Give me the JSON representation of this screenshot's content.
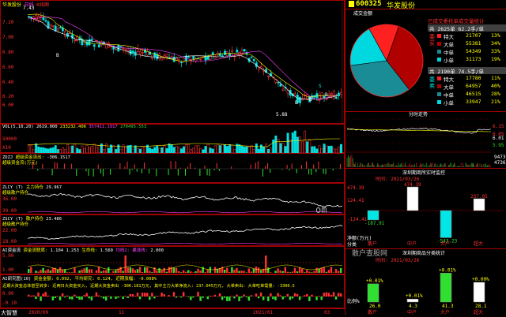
{
  "stock": {
    "code": "600325",
    "name": "华发股份"
  },
  "main_chart": {
    "title_left": "华发股份",
    "title_tags": [
      "日线",
      "K线图"
    ],
    "y_ticks": [
      "7.20",
      "7.00",
      "6.80",
      "6.60",
      "6.40",
      "6.20",
      "6.00"
    ],
    "high_label": "7.43",
    "low_label": "5.88",
    "marks": [
      "B",
      "S",
      "B",
      "B",
      "S",
      "B"
    ]
  },
  "vol_panel": {
    "title": "VOL(5,10,20)",
    "values": [
      "2619.000",
      "233232.406",
      "357411.1917",
      "270495.553"
    ],
    "y_ticks": [
      "50000",
      "X10"
    ]
  },
  "zdzj_panel": {
    "title": "ZDZJ",
    "subtitle": "超级资金流出:",
    "value": "-306.1517",
    "label2": "超级资金流(万元)"
  },
  "zlcy_panel": {
    "title": "ZLCY (T)",
    "subtitle": "主力持仓",
    "value": "29.967",
    "label2": "超级散户持仓",
    "y_ticks": [
      "36.00",
      "30.00"
    ]
  },
  "shcy_panel": {
    "title": "ZSCY (T)",
    "subtitle": "散户持仓",
    "value": "23.486",
    "label2": "超级散户持仓",
    "y_ticks": [
      "22.00",
      "18.00"
    ]
  },
  "kdj_panel": {
    "title": "AI资金流",
    "subtitle": "资金流联席:",
    "values": [
      "1.104",
      "1.253",
      "1.560",
      "2.000"
    ],
    "labels": [
      "生命线:",
      "均线2:",
      "暴涨线:"
    ],
    "y_ticks": [
      "5.00",
      "1.00"
    ]
  },
  "ai_panel": {
    "title": "AI研究图(10)",
    "text1": "资金金额: 0.092, 平均研究: 0.124, 近期涨幅: -0.008%",
    "text2": "近期大资金总体甚至转多: 近两日大资金买入, 近期大资金卖出 -306.181万元, 其中主力大单净流入: 237.045万元, 大单卖出: 大单吃单需量: -3300.5",
    "y_ticks": [
      "0.00",
      "-0.10"
    ]
  },
  "bottom_axis": {
    "labels": [
      "大智慧",
      "2020/09",
      "11",
      "2021/01",
      "03"
    ]
  },
  "pie_panel": {
    "title": "成交金额",
    "header": "已成交委托单成交量统计",
    "slices": [
      {
        "name": "特大",
        "value": 21707,
        "pct": 13,
        "color": "#ff2020"
      },
      {
        "name": "大单",
        "value": 55381,
        "pct": 34,
        "color": "#b00000"
      },
      {
        "name": "中单",
        "value": 54349,
        "pct": 33,
        "color": "#1a8c96"
      },
      {
        "name": "小单",
        "value": 31173,
        "pct": 19,
        "color": "#00d8e0"
      }
    ],
    "buy_title": "共 2625单 62.2手/单",
    "buy_side": "委买",
    "buy_rows": [
      {
        "name": "特大",
        "value": "21707",
        "pct": "13%"
      },
      {
        "name": "大单",
        "value": "55381",
        "pct": "34%"
      },
      {
        "name": "中单",
        "value": "54349",
        "pct": "33%"
      },
      {
        "name": "小单",
        "value": "31173",
        "pct": "19%"
      }
    ],
    "sell_title": "共 2190单 74.5手/单",
    "sell_side": "委卖",
    "sell_rows": [
      {
        "name": "特大",
        "value": "17780",
        "pct": "11%"
      },
      {
        "name": "大单",
        "value": "64957",
        "pct": "40%"
      },
      {
        "name": "中单",
        "value": "46515",
        "pct": "28%"
      },
      {
        "name": "小单",
        "value": "33947",
        "pct": "21%"
      }
    ]
  },
  "intraday": {
    "title": "分时走势",
    "right_ticks": [
      "6.15",
      "6.05",
      "6.01",
      "5.95"
    ],
    "vol_ticks": [
      "9473",
      "4736"
    ]
  },
  "flow_panel": {
    "title": "深圳期商所实时监控",
    "date": "时间: 2021/03/26",
    "y_ticks": [
      "474.39",
      "124.41",
      "-124.41"
    ],
    "bar_values": [
      "-187.91",
      "474.39",
      "-543.23",
      "237.05"
    ],
    "categories": [
      "散户",
      "中户",
      "大户",
      "超大"
    ],
    "note": "净额(万元)",
    "side": "分类"
  },
  "ratio_panel": {
    "title": "深圳期商品分类统计",
    "date": "时间: 2021/03/26",
    "watermark": "散户查股网",
    "pct_labels": [
      "+0.01%",
      "+0.01%",
      "+0.01%",
      "+0.00%"
    ],
    "bar_values": [
      "26.0",
      "4.3",
      "41.3",
      "28.1"
    ],
    "categories": [
      "散户",
      "中户",
      "大户",
      "超大"
    ],
    "note": "比例%"
  },
  "watermark": "om"
}
